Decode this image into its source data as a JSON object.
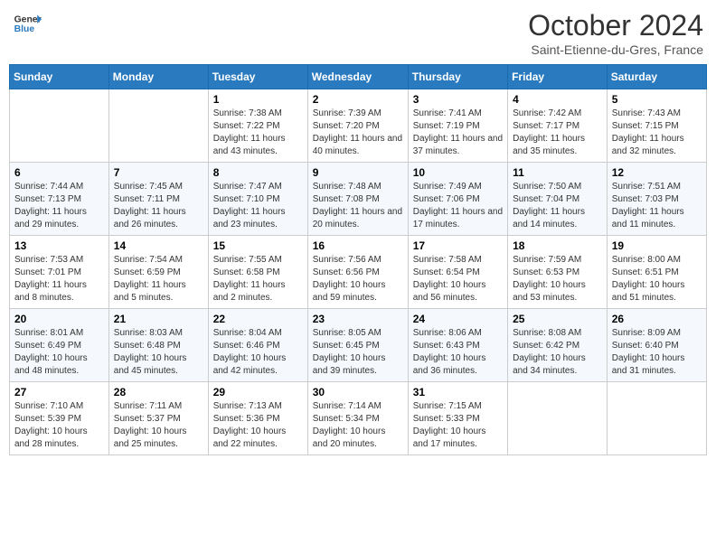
{
  "logo": {
    "line1": "General",
    "line2": "Blue"
  },
  "title": "October 2024",
  "location": "Saint-Etienne-du-Gres, France",
  "days_header": [
    "Sunday",
    "Monday",
    "Tuesday",
    "Wednesday",
    "Thursday",
    "Friday",
    "Saturday"
  ],
  "weeks": [
    [
      {
        "day": "",
        "info": ""
      },
      {
        "day": "",
        "info": ""
      },
      {
        "day": "1",
        "info": "Sunrise: 7:38 AM\nSunset: 7:22 PM\nDaylight: 11 hours and 43 minutes."
      },
      {
        "day": "2",
        "info": "Sunrise: 7:39 AM\nSunset: 7:20 PM\nDaylight: 11 hours and 40 minutes."
      },
      {
        "day": "3",
        "info": "Sunrise: 7:41 AM\nSunset: 7:19 PM\nDaylight: 11 hours and 37 minutes."
      },
      {
        "day": "4",
        "info": "Sunrise: 7:42 AM\nSunset: 7:17 PM\nDaylight: 11 hours and 35 minutes."
      },
      {
        "day": "5",
        "info": "Sunrise: 7:43 AM\nSunset: 7:15 PM\nDaylight: 11 hours and 32 minutes."
      }
    ],
    [
      {
        "day": "6",
        "info": "Sunrise: 7:44 AM\nSunset: 7:13 PM\nDaylight: 11 hours and 29 minutes."
      },
      {
        "day": "7",
        "info": "Sunrise: 7:45 AM\nSunset: 7:11 PM\nDaylight: 11 hours and 26 minutes."
      },
      {
        "day": "8",
        "info": "Sunrise: 7:47 AM\nSunset: 7:10 PM\nDaylight: 11 hours and 23 minutes."
      },
      {
        "day": "9",
        "info": "Sunrise: 7:48 AM\nSunset: 7:08 PM\nDaylight: 11 hours and 20 minutes."
      },
      {
        "day": "10",
        "info": "Sunrise: 7:49 AM\nSunset: 7:06 PM\nDaylight: 11 hours and 17 minutes."
      },
      {
        "day": "11",
        "info": "Sunrise: 7:50 AM\nSunset: 7:04 PM\nDaylight: 11 hours and 14 minutes."
      },
      {
        "day": "12",
        "info": "Sunrise: 7:51 AM\nSunset: 7:03 PM\nDaylight: 11 hours and 11 minutes."
      }
    ],
    [
      {
        "day": "13",
        "info": "Sunrise: 7:53 AM\nSunset: 7:01 PM\nDaylight: 11 hours and 8 minutes."
      },
      {
        "day": "14",
        "info": "Sunrise: 7:54 AM\nSunset: 6:59 PM\nDaylight: 11 hours and 5 minutes."
      },
      {
        "day": "15",
        "info": "Sunrise: 7:55 AM\nSunset: 6:58 PM\nDaylight: 11 hours and 2 minutes."
      },
      {
        "day": "16",
        "info": "Sunrise: 7:56 AM\nSunset: 6:56 PM\nDaylight: 10 hours and 59 minutes."
      },
      {
        "day": "17",
        "info": "Sunrise: 7:58 AM\nSunset: 6:54 PM\nDaylight: 10 hours and 56 minutes."
      },
      {
        "day": "18",
        "info": "Sunrise: 7:59 AM\nSunset: 6:53 PM\nDaylight: 10 hours and 53 minutes."
      },
      {
        "day": "19",
        "info": "Sunrise: 8:00 AM\nSunset: 6:51 PM\nDaylight: 10 hours and 51 minutes."
      }
    ],
    [
      {
        "day": "20",
        "info": "Sunrise: 8:01 AM\nSunset: 6:49 PM\nDaylight: 10 hours and 48 minutes."
      },
      {
        "day": "21",
        "info": "Sunrise: 8:03 AM\nSunset: 6:48 PM\nDaylight: 10 hours and 45 minutes."
      },
      {
        "day": "22",
        "info": "Sunrise: 8:04 AM\nSunset: 6:46 PM\nDaylight: 10 hours and 42 minutes."
      },
      {
        "day": "23",
        "info": "Sunrise: 8:05 AM\nSunset: 6:45 PM\nDaylight: 10 hours and 39 minutes."
      },
      {
        "day": "24",
        "info": "Sunrise: 8:06 AM\nSunset: 6:43 PM\nDaylight: 10 hours and 36 minutes."
      },
      {
        "day": "25",
        "info": "Sunrise: 8:08 AM\nSunset: 6:42 PM\nDaylight: 10 hours and 34 minutes."
      },
      {
        "day": "26",
        "info": "Sunrise: 8:09 AM\nSunset: 6:40 PM\nDaylight: 10 hours and 31 minutes."
      }
    ],
    [
      {
        "day": "27",
        "info": "Sunrise: 7:10 AM\nSunset: 5:39 PM\nDaylight: 10 hours and 28 minutes."
      },
      {
        "day": "28",
        "info": "Sunrise: 7:11 AM\nSunset: 5:37 PM\nDaylight: 10 hours and 25 minutes."
      },
      {
        "day": "29",
        "info": "Sunrise: 7:13 AM\nSunset: 5:36 PM\nDaylight: 10 hours and 22 minutes."
      },
      {
        "day": "30",
        "info": "Sunrise: 7:14 AM\nSunset: 5:34 PM\nDaylight: 10 hours and 20 minutes."
      },
      {
        "day": "31",
        "info": "Sunrise: 7:15 AM\nSunset: 5:33 PM\nDaylight: 10 hours and 17 minutes."
      },
      {
        "day": "",
        "info": ""
      },
      {
        "day": "",
        "info": ""
      }
    ]
  ]
}
